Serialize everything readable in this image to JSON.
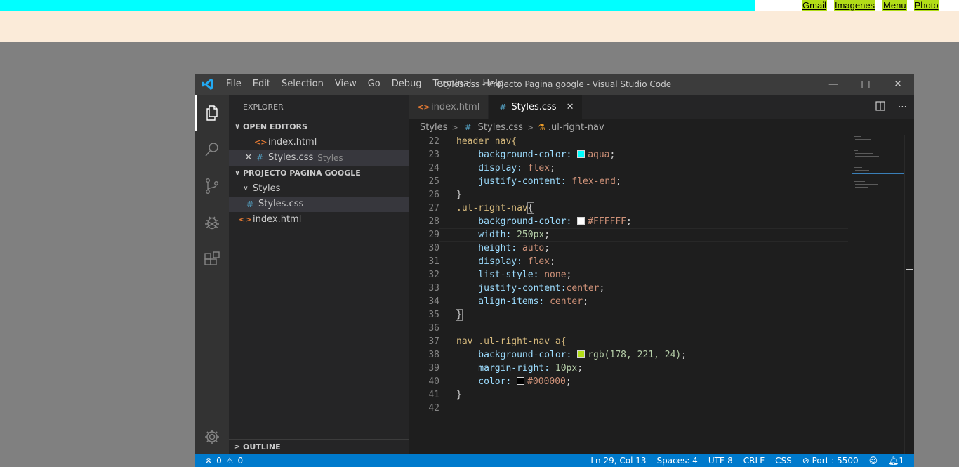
{
  "page": {
    "nav_links": [
      "Gmail",
      "Imagenes",
      "Menu",
      "Photo"
    ]
  },
  "window": {
    "title": "Styles.css - Projecto Pagina google - Visual Studio Code",
    "menu": [
      "File",
      "Edit",
      "Selection",
      "View",
      "Go",
      "Debug",
      "Terminal",
      "Help"
    ]
  },
  "sidebar": {
    "title": "EXPLORER",
    "open_editors_label": "OPEN EDITORS",
    "open_editors": [
      {
        "name": "index.html",
        "type": "html"
      },
      {
        "name": "Styles.css",
        "type": "css",
        "desc": "Styles"
      }
    ],
    "project_label": "PROJECTO PAGINA GOOGLE",
    "folder": "Styles",
    "folder_file": "Styles.css",
    "root_file": "index.html",
    "outline_label": "OUTLINE"
  },
  "tabs": [
    {
      "label": "index.html",
      "type": "html"
    },
    {
      "label": "Styles.css",
      "type": "css"
    }
  ],
  "breadcrumbs": [
    "Styles",
    "Styles.css",
    ".ul-right-nav"
  ],
  "code": {
    "line_numbers": [
      "22",
      "23",
      "24",
      "25",
      "26",
      "27",
      "28",
      "29",
      "30",
      "31",
      "32",
      "33",
      "34",
      "35",
      "36",
      "37",
      "38",
      "39",
      "40",
      "41",
      "42"
    ],
    "l22_sel": "header nav{",
    "l23_prop": "    background-color: ",
    "l23_val": "aqua",
    "l23_color": "#00ffff",
    "l24_prop": "    display: ",
    "l24_val": "flex",
    "l25_prop": "    justify-content: ",
    "l25_val": "flex-end",
    "l26": "}",
    "l27_sel": ".ul-right-nav",
    "l27_brace": "{",
    "l28_prop": "    background-color: ",
    "l28_val": "#FFFFFF",
    "l28_color": "#ffffff",
    "l29_prop": "    width: ",
    "l29_val": "250px",
    "l30_prop": "    height: ",
    "l30_val": "auto",
    "l31_prop": "    display: ",
    "l31_val": "flex",
    "l32_prop": "    list-style: ",
    "l32_val": "none",
    "l33_prop": "    justify-content:",
    "l33_val": "center",
    "l34_prop": "    align-items: ",
    "l34_val": "center",
    "l35": "}",
    "l37_sel": "nav .ul-right-nav a{",
    "l38_prop": "    background-color: ",
    "l38_val": "rgb(178, 221, 24)",
    "l38_color": "#b2dd18",
    "l39_prop": "    margin-right: ",
    "l39_val": "10px",
    "l40_prop": "    color: ",
    "l40_val": "#000000",
    "l40_color": "#000000",
    "l41": "}"
  },
  "status": {
    "errors": "0",
    "warnings": "0",
    "position": "Ln 29, Col 13",
    "spaces": "Spaces: 4",
    "encoding": "UTF-8",
    "eol": "CRLF",
    "language": "CSS",
    "port": "Port : 5500",
    "notifications": "1"
  }
}
